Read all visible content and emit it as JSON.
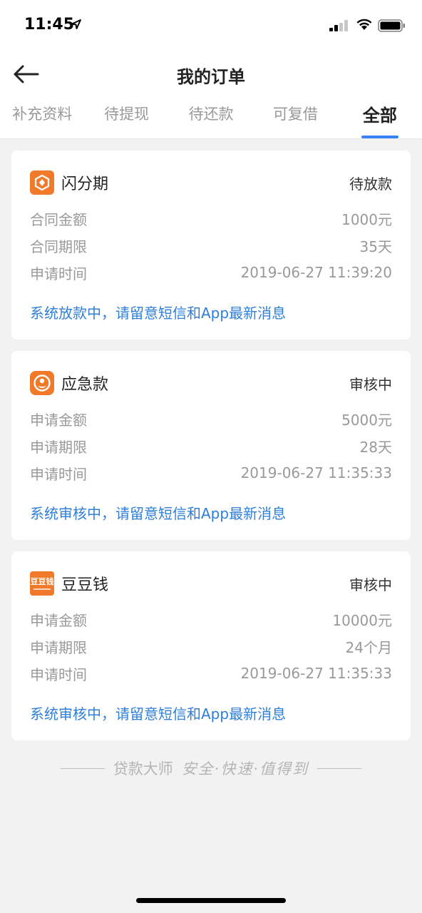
{
  "status_bar": {
    "time": "11:45"
  },
  "nav": {
    "title": "我的订单"
  },
  "tabs": [
    {
      "label": "补充资料"
    },
    {
      "label": "待提现"
    },
    {
      "label": "待还款"
    },
    {
      "label": "可复借"
    },
    {
      "label": "全部"
    }
  ],
  "orders": [
    {
      "name": "闪分期",
      "status": "待放款",
      "rows": [
        {
          "label": "合同金额",
          "value": "1000元"
        },
        {
          "label": "合同期限",
          "value": "35天"
        },
        {
          "label": "申请时间",
          "value": "2019-06-27 11:39:20"
        }
      ],
      "note": "系统放款中，请留意短信和App最新消息"
    },
    {
      "name": "应急款",
      "status": "审核中",
      "rows": [
        {
          "label": "申请金额",
          "value": "5000元"
        },
        {
          "label": "申请期限",
          "value": "28天"
        },
        {
          "label": "申请时间",
          "value": "2019-06-27 11:35:33"
        }
      ],
      "note": "系统审核中，请留意短信和App最新消息"
    },
    {
      "name": "豆豆钱",
      "logo_text": "豆豆钱",
      "status": "审核中",
      "rows": [
        {
          "label": "申请金额",
          "value": "10000元"
        },
        {
          "label": "申请期限",
          "value": "24个月"
        },
        {
          "label": "申请时间",
          "value": "2019-06-27 11:35:33"
        }
      ],
      "note": "系统审核中，请留意短信和App最新消息"
    }
  ],
  "footer": {
    "brand": "贷款大师",
    "motto": "安全·快速·值得到"
  },
  "colors": {
    "accent": "#3b82f6",
    "link": "#2f7fd8",
    "logo": "#f07a2a"
  }
}
